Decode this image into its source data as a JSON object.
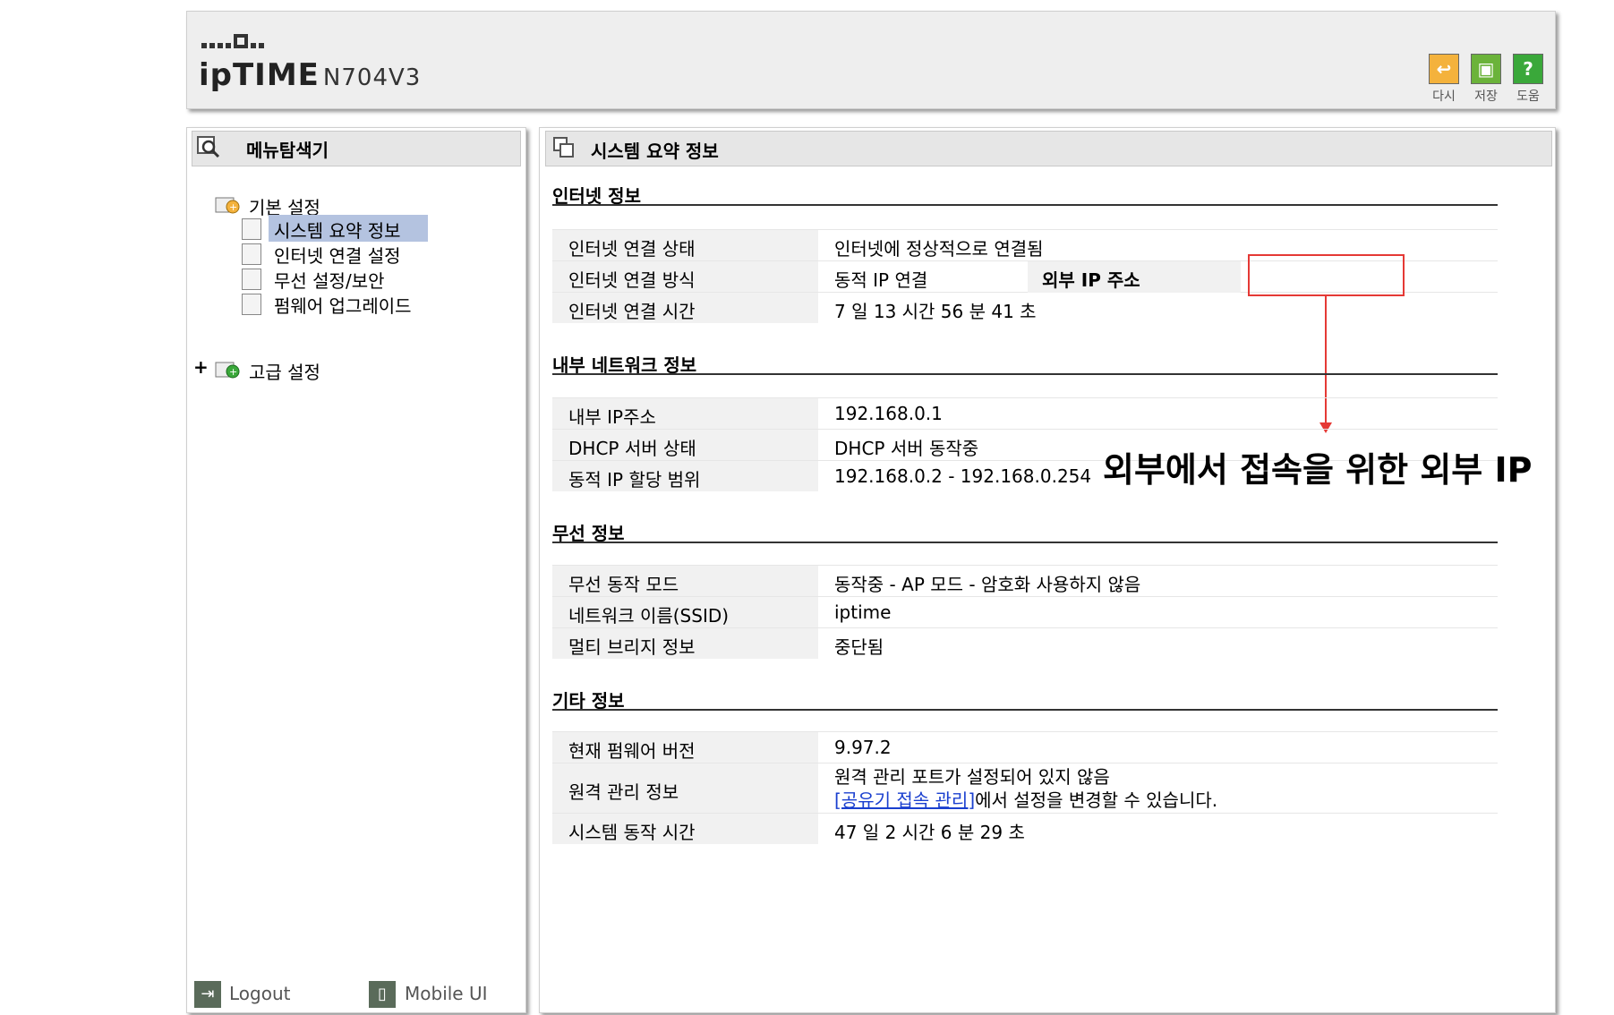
{
  "header": {
    "brand": "ipTIME",
    "model": "N704V3",
    "buttons": [
      {
        "label": "다시",
        "icon": "undo-icon",
        "color": "#f4b23c"
      },
      {
        "label": "저장",
        "icon": "save-icon",
        "color": "#6bb33a"
      },
      {
        "label": "도움",
        "icon": "help-icon",
        "color": "#3aa83a"
      }
    ]
  },
  "sidebar": {
    "title": "메뉴탐색기",
    "basic": {
      "label": "기본 설정",
      "items": [
        {
          "label": "시스템 요약 정보"
        },
        {
          "label": "인터넷 연결 설정"
        },
        {
          "label": "무선 설정/보안"
        },
        {
          "label": "펌웨어 업그레이드"
        }
      ]
    },
    "advanced": {
      "expander": "+",
      "label": "고급 설정"
    },
    "logout": "Logout",
    "mobile": "Mobile UI"
  },
  "main": {
    "title": "시스템 요약 정보",
    "internet": {
      "title": "인터넷 정보",
      "rows": [
        {
          "label": "인터넷 연결 상태",
          "value": "인터넷에 정상적으로 연결됨"
        },
        {
          "label": "인터넷 연결 방식",
          "value": "동적 IP 연결"
        },
        {
          "label": "인터넷 연결 시간",
          "value": "7 일 13 시간 56 분 41 초"
        }
      ],
      "external_ip_label": "외부 IP 주소"
    },
    "lan": {
      "title": "내부 네트워크 정보",
      "rows": [
        {
          "label": "내부 IP주소",
          "value": "192.168.0.1"
        },
        {
          "label": "DHCP 서버 상태",
          "value": "DHCP 서버 동작중"
        },
        {
          "label": "동적 IP 할당 범위",
          "value": "192.168.0.2 -  192.168.0.254"
        }
      ]
    },
    "wireless": {
      "title": "무선 정보",
      "rows": [
        {
          "label": "무선 동작 모드",
          "value": "동작중 - AP 모드 - 암호화 사용하지 않음"
        },
        {
          "label": "네트워크 이름(SSID)",
          "value": "iptime"
        },
        {
          "label": "멀티 브리지 정보",
          "value": "중단됨"
        }
      ]
    },
    "etc": {
      "title": "기타 정보",
      "rows": [
        {
          "label": "현재 펌웨어 버전",
          "value": "9.97.2"
        },
        {
          "label": "원격 관리 정보",
          "value": "원격 관리 포트가 설정되어 있지 않음",
          "link": "[공유기 접속 관리]",
          "suffix": "에서 설정을 변경할 수 있습니다."
        },
        {
          "label": "시스템 동작 시간",
          "value": "47 일 2 시간 6 분 29 초"
        }
      ]
    }
  },
  "annotation": {
    "text": "외부에서 접속을 위한 외부 IP",
    "color": "#e53935"
  }
}
